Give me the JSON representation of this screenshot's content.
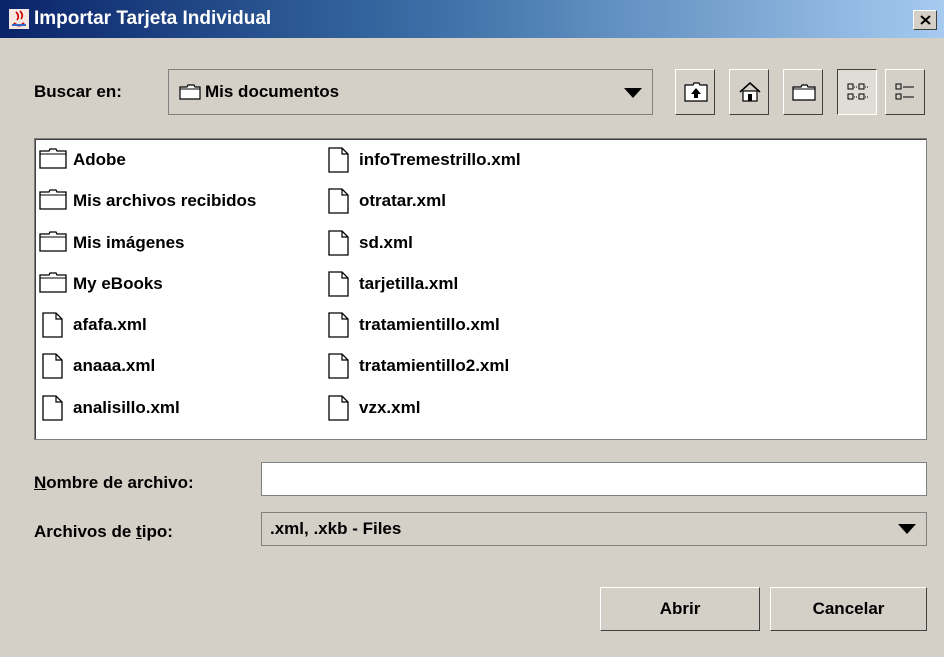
{
  "window": {
    "title": "Importar Tarjeta Individual"
  },
  "look_in": {
    "label": "Buscar en:",
    "value": "Mis documentos"
  },
  "toolbar": {
    "buttons": [
      {
        "icon": "up-folder-icon"
      },
      {
        "icon": "home-icon"
      },
      {
        "icon": "new-folder-icon"
      },
      {
        "icon": "list-view-icon"
      },
      {
        "icon": "details-view-icon"
      }
    ]
  },
  "files": {
    "column1": [
      {
        "name": "Adobe",
        "type": "folder"
      },
      {
        "name": "Mis archivos recibidos",
        "type": "folder"
      },
      {
        "name": "Mis imágenes",
        "type": "folder"
      },
      {
        "name": "My eBooks",
        "type": "folder"
      },
      {
        "name": "afafa.xml",
        "type": "file"
      },
      {
        "name": "anaaa.xml",
        "type": "file"
      },
      {
        "name": "analisillo.xml",
        "type": "file"
      }
    ],
    "column2": [
      {
        "name": "infoTremestrillo.xml",
        "type": "file"
      },
      {
        "name": "otratar.xml",
        "type": "file"
      },
      {
        "name": "sd.xml",
        "type": "file"
      },
      {
        "name": "tarjetilla.xml",
        "type": "file"
      },
      {
        "name": "tratamientillo.xml",
        "type": "file"
      },
      {
        "name": "tratamientillo2.xml",
        "type": "file"
      },
      {
        "name": "vzx.xml",
        "type": "file"
      }
    ]
  },
  "file_name": {
    "label_first": "N",
    "label_rest": "ombre de archivo:",
    "value": ""
  },
  "file_type": {
    "label_a": "Archivos de ",
    "label_u": "t",
    "label_b": "ipo:",
    "value": ".xml, .xkb - Files"
  },
  "buttons": {
    "open": "Abrir",
    "cancel": "Cancelar"
  }
}
